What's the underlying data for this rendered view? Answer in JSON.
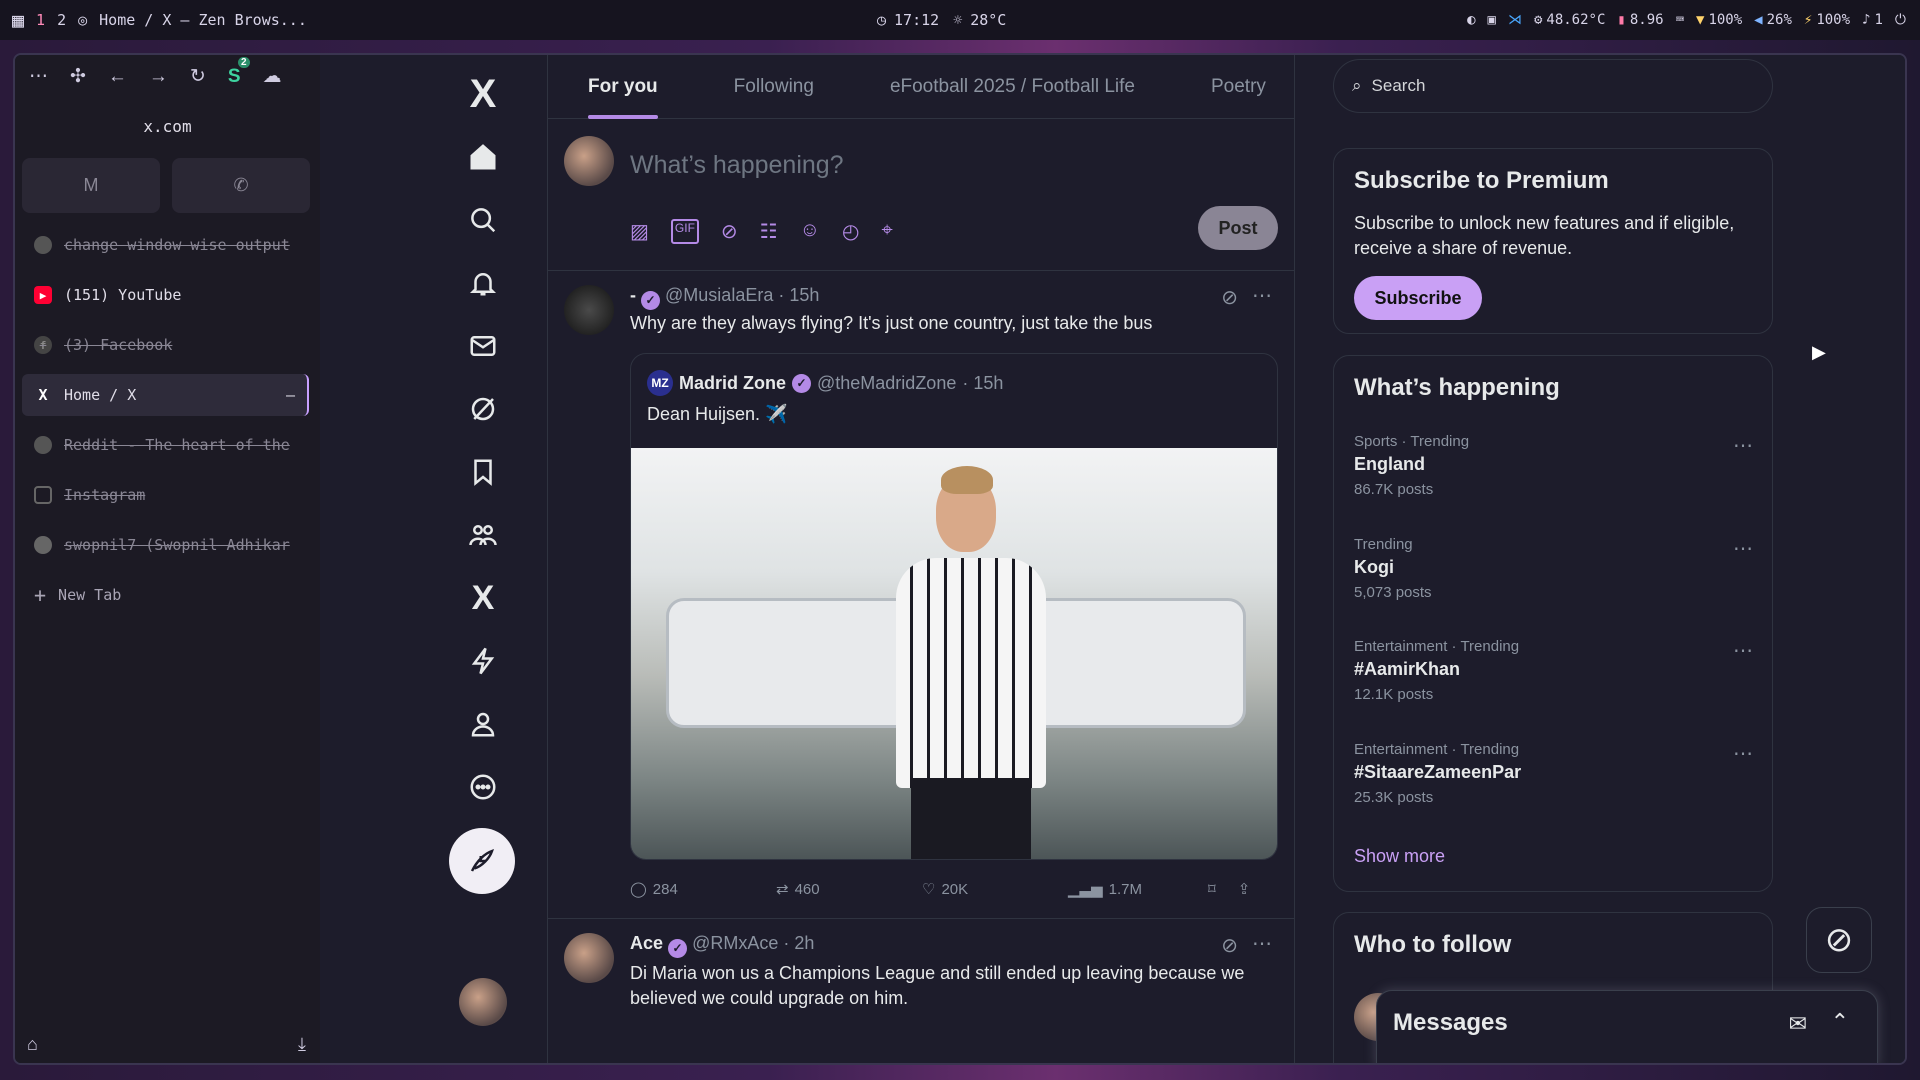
{
  "topbar": {
    "workspace_1": "1",
    "workspace_2": "2",
    "window_title": "Home / X — Zen Brows...",
    "time": "17:12",
    "weather": "28°C",
    "cpu_temp": "48.62°C",
    "memory": "8.96",
    "wifi": "100%",
    "volume": "26%",
    "battery": "100%",
    "notifications": "1"
  },
  "browser": {
    "url": "x.com",
    "badge_count": "2",
    "tabs": [
      {
        "label": "change window wise output",
        "state": "dim",
        "icon": "chrome-icon"
      },
      {
        "label": "(151) YouTube",
        "state": "normal",
        "icon": "youtube-icon"
      },
      {
        "label": "(3) Facebook",
        "state": "dim",
        "icon": "facebook-icon"
      },
      {
        "label": "Home / X",
        "state": "active",
        "icon": "x-icon"
      },
      {
        "label": "Reddit - The heart of the",
        "state": "dim",
        "icon": "reddit-icon"
      },
      {
        "label": "Instagram",
        "state": "dim",
        "icon": "instagram-icon"
      },
      {
        "label": "swopnil7 (Swopnil Adhikar",
        "state": "dim",
        "icon": "github-icon"
      }
    ],
    "new_tab": "New Tab"
  },
  "feed": {
    "tabs": [
      "For you",
      "Following",
      "eFootball 2025 / Football Life",
      "Poetry"
    ],
    "compose_placeholder": "What’s happening?",
    "post_button": "Post",
    "post1": {
      "name": "-",
      "handle": "@MusialaEra",
      "time": "· 15h",
      "text": "Why are they always flying? It's just one country, just take the bus",
      "quote": {
        "logo": "MZ",
        "name": "Madrid Zone",
        "handle": "@theMadridZone",
        "time": "· 15h",
        "text": "Dean Huijsen. ✈️"
      },
      "replies": "284",
      "reposts": "460",
      "likes": "20K",
      "views": "1.7M"
    },
    "post2": {
      "name": "Ace",
      "handle": "@RMxAce",
      "time": "· 2h",
      "text": "Di Maria won us a Champions League and still ended up leaving because we believed we could upgrade on him."
    }
  },
  "sidebar": {
    "search_placeholder": "Search",
    "premium": {
      "title": "Subscribe to Premium",
      "text": "Subscribe to unlock new features and if eligible, receive a share of revenue.",
      "button": "Subscribe"
    },
    "happening": {
      "title": "What’s happening",
      "trends": [
        {
          "category": "Sports · Trending",
          "name": "England",
          "count": "86.7K posts"
        },
        {
          "category": "Trending",
          "name": "Kogi",
          "count": "5,073 posts"
        },
        {
          "category": "Entertainment · Trending",
          "name": "#AamirKhan",
          "count": "12.1K posts"
        },
        {
          "category": "Entertainment · Trending",
          "name": "#SitaareZameenPar",
          "count": "25.3K posts"
        }
      ],
      "show_more": "Show more"
    },
    "who_to_follow": "Who to follow",
    "messages": "Messages"
  },
  "colors": {
    "accent": "#b48ae6",
    "background": "#1d1c2b",
    "border": "#2f3340"
  }
}
